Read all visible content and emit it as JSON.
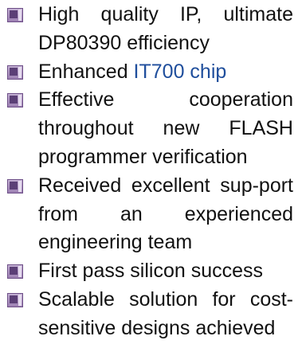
{
  "items": [
    {
      "text": "High quality IP, ultimate DP80390 efficiency"
    },
    {
      "text": "Enhanced ",
      "link": "IT700 chip"
    },
    {
      "text": "Effective cooperation throughout new FLASH programmer verification"
    },
    {
      "text": "Received excellent sup-port from an experienced engineering team"
    },
    {
      "text": "First pass silicon success"
    },
    {
      "text": "Scalable solution for cost-sensitive designs achieved"
    }
  ],
  "colors": {
    "text": "#111111",
    "link": "#1f4e9c",
    "bullet": "#8a6aa6"
  },
  "icons": {
    "bullet": "square-bullet-icon"
  }
}
